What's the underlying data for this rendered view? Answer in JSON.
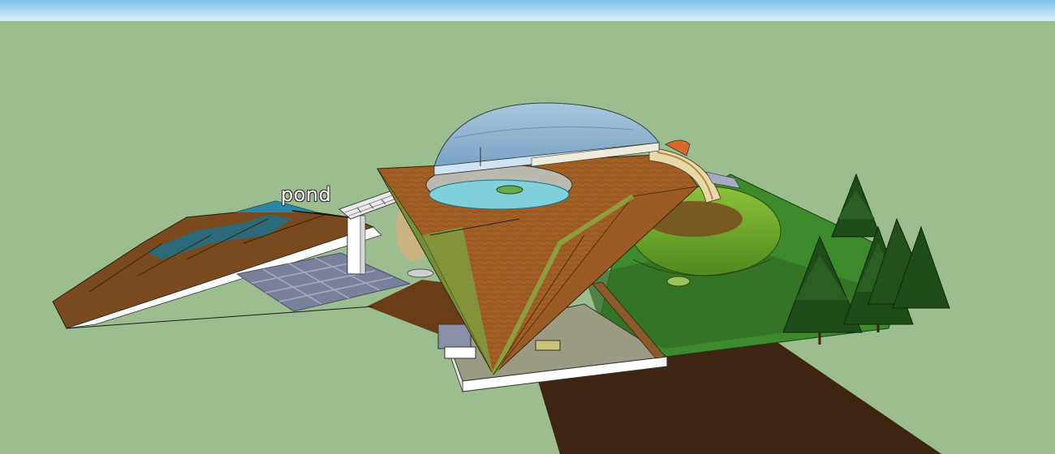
{
  "scene": {
    "annotation_text": "pond",
    "colors": {
      "sky_top": "#7fc0ea",
      "sky_bottom": "#d9effb",
      "ground": "#9bbd8f",
      "lawn": "#3c8a2c",
      "soil": "#3e2511",
      "earth": "#7a4a1e",
      "dome_glass": "#8fb6d8",
      "pool_water": "#7fd0d8",
      "paving": "#7a7f9a",
      "tree": "#1f4a1a"
    },
    "objects": [
      "sky",
      "ground-plane",
      "hill-terrain",
      "paving-grid",
      "dome",
      "roof-deck",
      "pool",
      "inverted-pyramid",
      "green-mound",
      "lawn",
      "dirt-road",
      "pine-trees",
      "walkway-bridge",
      "support-pillar",
      "base-slab"
    ]
  }
}
